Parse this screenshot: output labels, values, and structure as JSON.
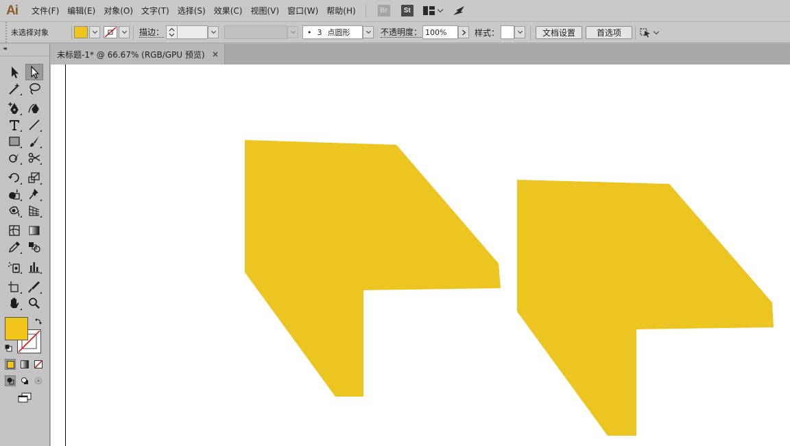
{
  "app": {
    "logo": "Ai"
  },
  "menu": [
    "文件(F)",
    "编辑(E)",
    "对象(O)",
    "文字(T)",
    "选择(S)",
    "效果(C)",
    "视图(V)",
    "窗口(W)",
    "帮助(H)"
  ],
  "bridge_badge": "Br",
  "stock_badge": "St",
  "control": {
    "selection_status": "未选择对象",
    "fill_color": "#f0c419",
    "stroke_label": "描边：",
    "brush_dot": "•",
    "brush_value": "3",
    "brush_name": "点圆形",
    "opacity_label": "不透明度：",
    "opacity_value": "100%",
    "style_label": "样式：",
    "doc_setup_button": "文档设置",
    "preferences_button": "首选项"
  },
  "document_tab": {
    "title": "未标题-1* @ 66.67% (RGB/GPU 预览)",
    "close_symbol": "×"
  },
  "toolbox": {
    "grip": "◂◂",
    "fill_color": "#f0c419",
    "stroke_color": "none",
    "tools": [
      "selection-tool",
      "direct-selection-tool",
      "magic-wand-tool",
      "lasso-tool",
      "pen-tool",
      "curvature-tool",
      "type-tool",
      "line-segment-tool",
      "rectangle-tool",
      "paintbrush-tool",
      "shaper-tool",
      "scissors-tool",
      "rotate-tool",
      "scale-tool",
      "shape-builder-tool",
      "puppet-warp-tool",
      "live-paint-tool",
      "perspective-grid-tool",
      "mesh-tool",
      "gradient-tool",
      "eyedropper-tool",
      "blend-tool",
      "symbol-sprayer-tool",
      "column-graph-tool",
      "artboard-tool",
      "slice-tool",
      "hand-tool",
      "zoom-tool"
    ],
    "selected_tool": "direct-selection-tool"
  },
  "canvas": {
    "background": "#ffffff",
    "shape_fill": "#edc520",
    "shape_count": 2
  }
}
